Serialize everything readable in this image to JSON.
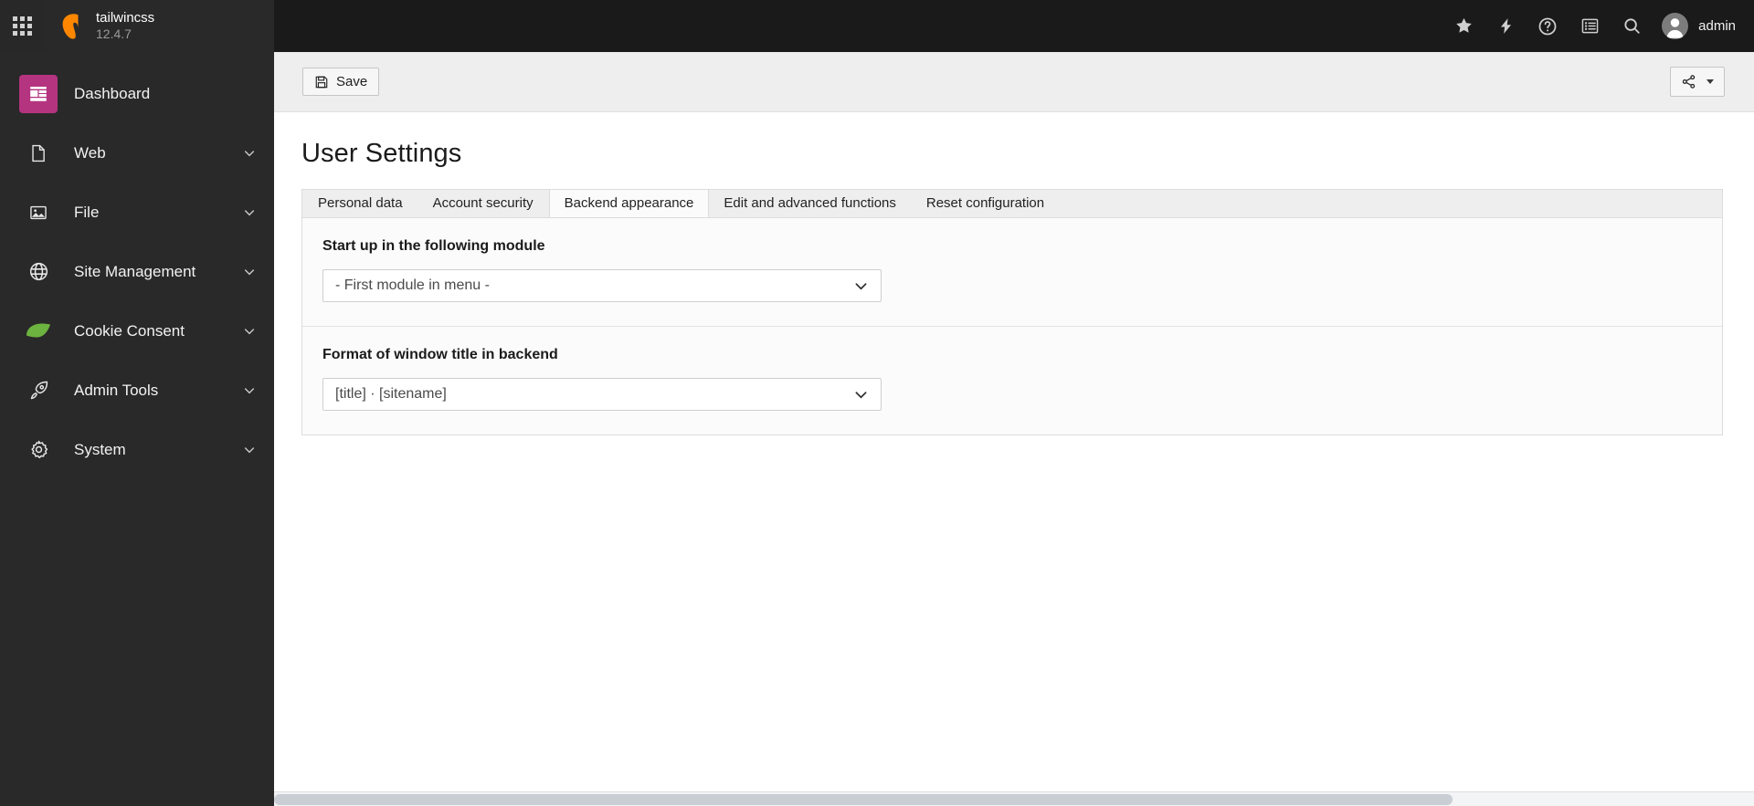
{
  "topbar": {
    "apps_icon": "apps-grid-icon",
    "brand": {
      "name": "tailwincss",
      "version": "12.4.7",
      "logo_icon": "typo3-logo-icon"
    },
    "icons": [
      {
        "name": "bookmark-star-icon",
        "label": "Bookmarks"
      },
      {
        "name": "flash-lightning-icon",
        "label": "Clear cache"
      },
      {
        "name": "help-question-icon",
        "label": "Help"
      },
      {
        "name": "systeminformation-list-icon",
        "label": "System information"
      },
      {
        "name": "search-icon",
        "label": "Search"
      }
    ],
    "user": {
      "name": "admin",
      "avatar_icon": "user-avatar-icon"
    }
  },
  "sidebar": {
    "items": [
      {
        "label": "Dashboard",
        "icon": "dashboard-icon",
        "active": true,
        "expandable": false
      },
      {
        "label": "Web",
        "icon": "page-document-icon",
        "active": false,
        "expandable": true
      },
      {
        "label": "File",
        "icon": "image-file-icon",
        "active": false,
        "expandable": true
      },
      {
        "label": "Site Management",
        "icon": "globe-icon",
        "active": false,
        "expandable": true
      },
      {
        "label": "Cookie Consent",
        "icon": "leaf-icon",
        "active": false,
        "expandable": true
      },
      {
        "label": "Admin Tools",
        "icon": "rocket-icon",
        "active": false,
        "expandable": true
      },
      {
        "label": "System",
        "icon": "gear-icon",
        "active": false,
        "expandable": true
      }
    ]
  },
  "docheader": {
    "save_label": "Save",
    "save_icon": "floppy-save-icon",
    "share_icon": "share-nodes-icon"
  },
  "main": {
    "page_title": "User Settings",
    "tabs": [
      {
        "label": "Personal data",
        "active": false
      },
      {
        "label": "Account security",
        "active": false
      },
      {
        "label": "Backend appearance",
        "active": true
      },
      {
        "label": "Edit and advanced functions",
        "active": false
      },
      {
        "label": "Reset configuration",
        "active": false
      }
    ],
    "fields": [
      {
        "label": "Start up in the following module",
        "value": "- First module in menu -",
        "chevron_icon": "chevron-down-icon"
      },
      {
        "label": "Format of window title in backend",
        "value": "[title] · [sitename]",
        "chevron_icon": "chevron-down-icon"
      }
    ]
  },
  "colors": {
    "topbar_bg": "#1a1a1a",
    "sidebar_bg": "#292929",
    "accent_magenta": "#b5347f",
    "leaf_green": "#6db33f",
    "typo3_orange": "#ff8700",
    "docheader_bg": "#eeeeee"
  }
}
